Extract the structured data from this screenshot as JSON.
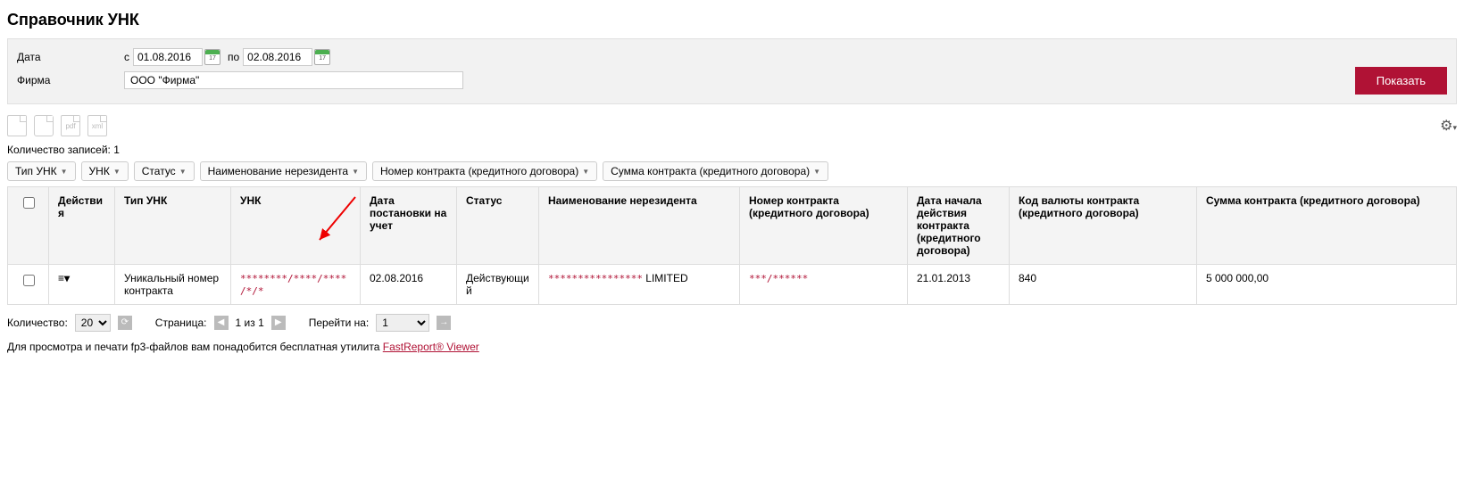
{
  "page_title": "Справочник УНК",
  "filters": {
    "date_label": "Дата",
    "date_prefix_from": "с",
    "date_from": "01.08.2016",
    "date_prefix_to": "по",
    "date_to": "02.08.2016",
    "firm_label": "Фирма",
    "firm_value": "ООО \"Фирма\"",
    "show_button": "Показать"
  },
  "toolbar_icons": {
    "pdf": "pdf",
    "xml": "xml"
  },
  "records_count_label": "Количество записей: 1",
  "filter_chips": [
    "Тип УНК",
    "УНК",
    "Статус",
    "Наименование нерезидента",
    "Номер контракта (кредитного договора)",
    "Сумма контракта (кредитного договора)"
  ],
  "table": {
    "headers": {
      "actions": "Действия",
      "type": "Тип УНК",
      "unk": "УНК",
      "reg_date": "Дата постановки на учет",
      "status": "Статус",
      "nonresident": "Наименование нерезидента",
      "contract_num": "Номер контракта (кредитного договора)",
      "start_date": "Дата начала действия контракта (кредитного договора)",
      "currency": "Код валюты контракта (кредитного договора)",
      "sum": "Сумма контракта (кредитного договора)"
    },
    "row": {
      "type": "Уникальный номер контракта",
      "unk": "********/****/****/*/*",
      "reg_date": "02.08.2016",
      "status": "Действующий",
      "nonresident_masked": "****************",
      "nonresident_tail": " LIMITED",
      "contract_num": "***/******",
      "start_date": "21.01.2013",
      "currency": "840",
      "sum": "5 000 000,00"
    }
  },
  "pager": {
    "qty_label": "Количество:",
    "qty_value": "20",
    "page_label": "Страница:",
    "page_text": "1 из 1",
    "goto_label": "Перейти на:",
    "goto_value": "1"
  },
  "footnote": {
    "text": "Для просмотра и печати fp3-файлов вам понадобится бесплатная утилита ",
    "link": "FastReport® Viewer"
  }
}
